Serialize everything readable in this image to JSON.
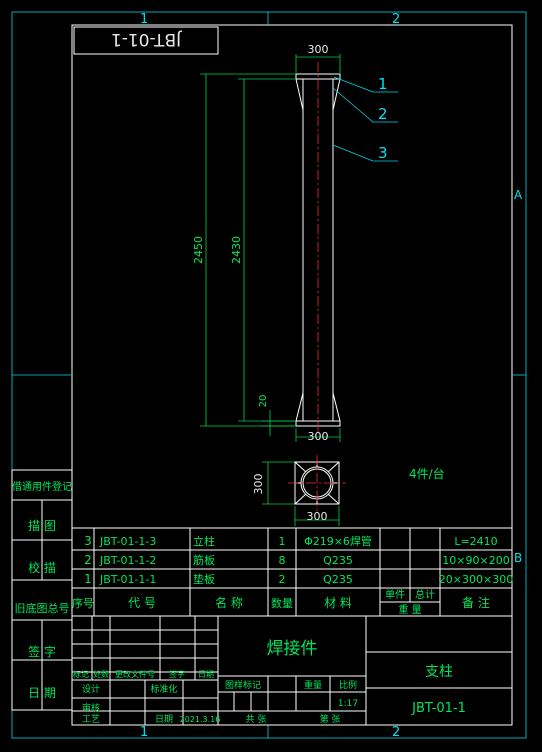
{
  "grid_labels": {
    "top_1": "1",
    "top_2": "2",
    "bottom_1": "1",
    "bottom_2": "2",
    "right_a": "A",
    "right_b": "B"
  },
  "stamp_box": "JBT-01-1",
  "dims": {
    "top_width": "300",
    "total_height": "2450",
    "inner_height": "2430",
    "bottom_offset": "20",
    "bottom_width": "300",
    "plan_height": "300",
    "plan_width": "300"
  },
  "callouts": [
    "1",
    "2",
    "3"
  ],
  "quantity_note": "4件/台",
  "left_strip": [
    "借通用件登记",
    "描 图",
    "校 描",
    "旧底图总号",
    "签 字",
    "日 期"
  ],
  "parts_header": {
    "seq": "序号",
    "code": "代 号",
    "name": "名 称",
    "qty": "数量",
    "material": "材 料",
    "unit_weight": "单件",
    "total_weight": "总计",
    "weight": "重 量",
    "remark": "备 注"
  },
  "parts": [
    {
      "seq": "3",
      "code": "JBT-01-1-3",
      "name": "立柱",
      "qty": "1",
      "material": "Φ219×6焊管",
      "remark": "L=2410"
    },
    {
      "seq": "2",
      "code": "JBT-01-1-2",
      "name": "筋板",
      "qty": "8",
      "material": "Q235",
      "remark": "10×90×200"
    },
    {
      "seq": "1",
      "code": "JBT-01-1-1",
      "name": "垫板",
      "qty": "2",
      "material": "Q235",
      "remark": "20×300×300"
    }
  ],
  "title_block": {
    "part_type": "焊接件",
    "drawing_name": "支柱",
    "drawing_number": "JBT-01-1",
    "rev_headers": [
      "标记",
      "处数",
      "更改文件号",
      "签字",
      "日期"
    ],
    "design": "设计",
    "standardize": "标准化",
    "review": "审核",
    "process": "工艺",
    "date_label": "日期",
    "date_value": "2021.3.16",
    "stage_mark": "图样标记",
    "weight": "重量",
    "scale_label": "比例",
    "scale_value": "1:17",
    "total_sheets": "共 张",
    "sheet": "第 张"
  }
}
